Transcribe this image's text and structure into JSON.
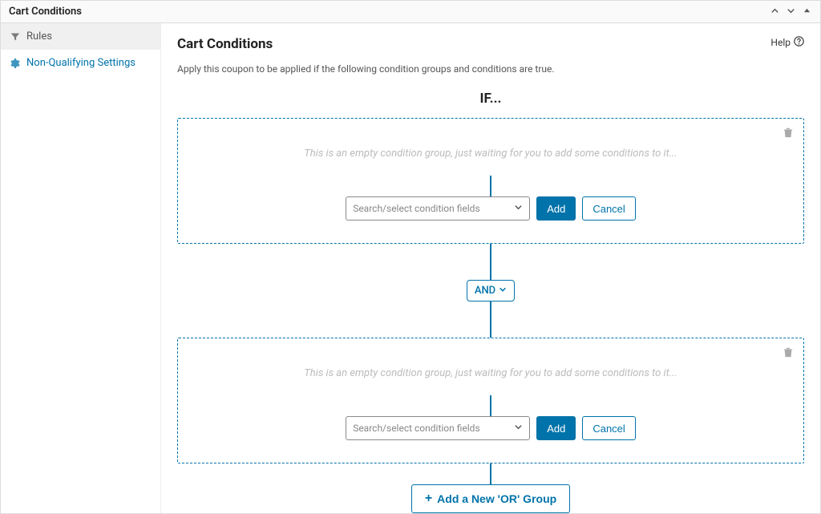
{
  "panel": {
    "title": "Cart Conditions"
  },
  "sidebar": {
    "rules_label": "Rules",
    "nonqual_label": "Non-Qualifying Settings"
  },
  "main": {
    "title": "Cart Conditions",
    "help_label": "Help",
    "subtitle": "Apply this coupon to be applied if the following condition groups and conditions are true.",
    "if_label": "IF...",
    "and_label": "AND",
    "add_or_label": "Add a New 'OR' Group",
    "groups": [
      {
        "empty_text": "This is an empty condition group, just waiting for you to add some conditions to it...",
        "select_placeholder": "Search/select condition fields",
        "add_label": "Add",
        "cancel_label": "Cancel"
      },
      {
        "empty_text": "This is an empty condition group, just waiting for you to add some conditions to it...",
        "select_placeholder": "Search/select condition fields",
        "add_label": "Add",
        "cancel_label": "Cancel"
      }
    ]
  }
}
